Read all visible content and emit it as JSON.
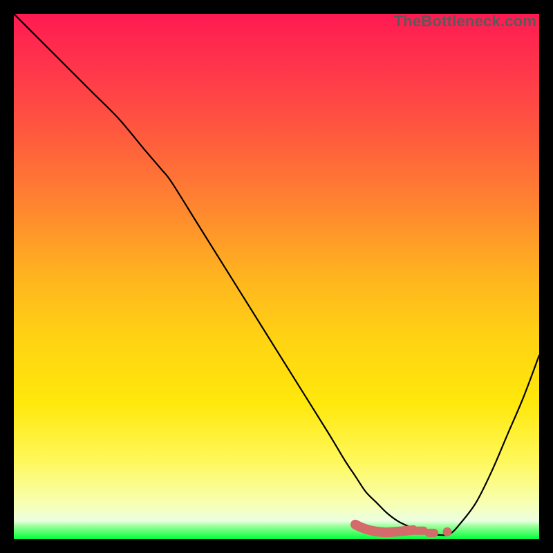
{
  "watermark": "TheBottleneck.com",
  "colors": {
    "frame": "#000000",
    "curve": "#000000",
    "green_band": "#00ff3a",
    "marker": "#d46a6a",
    "gradient_stops": [
      {
        "offset": 0.0,
        "color": "#ff1a52"
      },
      {
        "offset": 0.12,
        "color": "#ff3a4a"
      },
      {
        "offset": 0.25,
        "color": "#ff603c"
      },
      {
        "offset": 0.38,
        "color": "#ff8a2e"
      },
      {
        "offset": 0.5,
        "color": "#ffb41f"
      },
      {
        "offset": 0.62,
        "color": "#ffd313"
      },
      {
        "offset": 0.74,
        "color": "#ffe80b"
      },
      {
        "offset": 0.85,
        "color": "#fff85a"
      },
      {
        "offset": 0.93,
        "color": "#f8ffb0"
      },
      {
        "offset": 0.965,
        "color": "#ecffe0"
      },
      {
        "offset": 0.975,
        "color": "#9cff9c"
      },
      {
        "offset": 1.0,
        "color": "#00ff3a"
      }
    ]
  },
  "chart_data": {
    "type": "line",
    "title": "",
    "xlabel": "",
    "ylabel": "",
    "xlim": [
      0,
      100
    ],
    "ylim": [
      0,
      100
    ],
    "x": [
      0,
      5,
      10,
      15,
      20,
      25,
      28,
      30,
      35,
      40,
      45,
      50,
      55,
      60,
      63,
      65,
      67,
      69,
      71,
      73,
      75,
      77,
      79,
      81,
      83,
      85,
      88,
      91,
      94,
      97,
      100
    ],
    "values": [
      100,
      95,
      90,
      85,
      80,
      74,
      70.5,
      68,
      60,
      52,
      44,
      36,
      28,
      20,
      15,
      12,
      9,
      7,
      5,
      3.5,
      2.5,
      1.8,
      1.2,
      0.8,
      1,
      3,
      7,
      13,
      20,
      27,
      35
    ],
    "markers": {
      "plateau_x_range": [
        65,
        76
      ],
      "plateau_y": 2.0,
      "dashes": [
        {
          "x0": 76.5,
          "x1": 78.0,
          "y": 1.6
        },
        {
          "x0": 79.0,
          "x1": 80.0,
          "y": 1.2
        }
      ],
      "dot": {
        "x": 82.5,
        "y": 1.4
      }
    }
  }
}
